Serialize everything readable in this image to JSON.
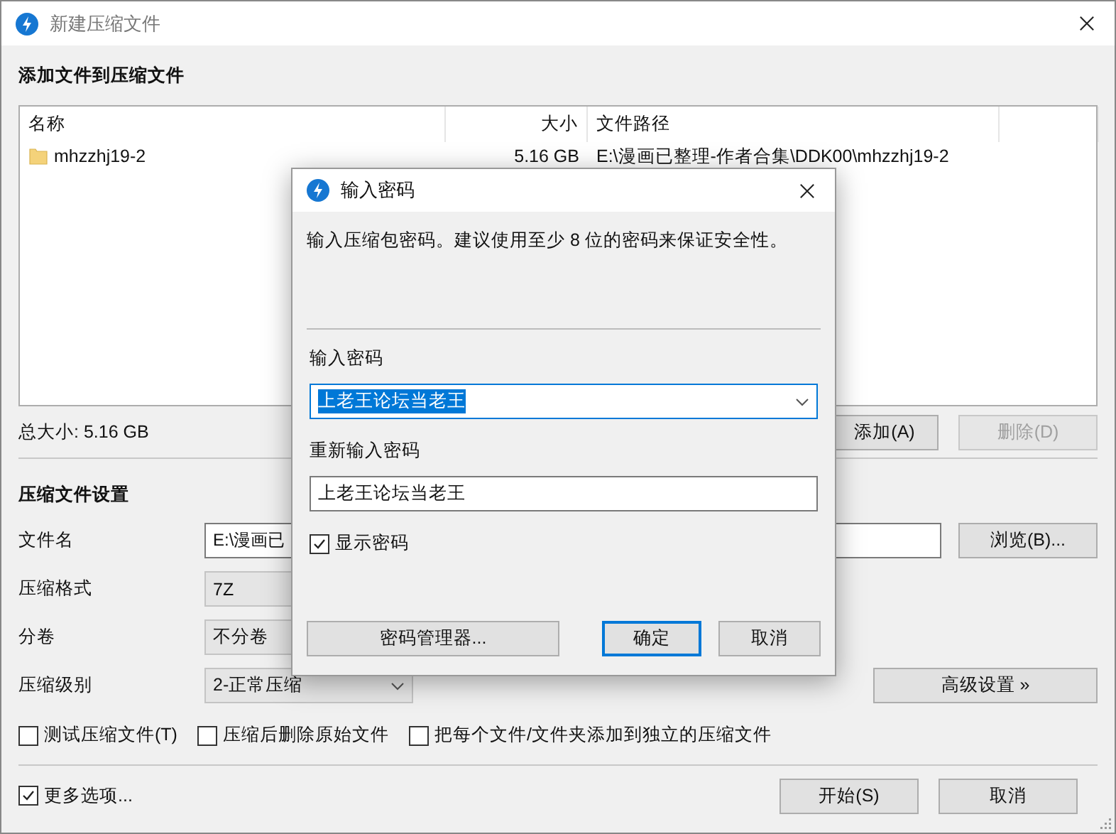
{
  "window": {
    "title": "新建压缩文件"
  },
  "files_section": {
    "heading": "添加文件到压缩文件",
    "columns": [
      "名称",
      "大小",
      "文件路径"
    ],
    "rows": [
      {
        "name": "mhzzhj19-2",
        "size": "5.16 GB",
        "path": "E:\\漫画已整理-作者合集\\DDK00\\mhzzhj19-2"
      }
    ],
    "total": "总大小: 5.16 GB",
    "buttons": [
      {
        "label": "添加(A)",
        "disabled": false
      },
      {
        "label": "删除(D)",
        "disabled": true
      }
    ]
  },
  "settings": {
    "heading": "压缩文件设置",
    "filename": {
      "label": "文件名",
      "value": "E:\\漫画已"
    },
    "browse_button": "浏览(B)...",
    "format": {
      "label": "压缩格式",
      "value": "7Z"
    },
    "split": {
      "label": "分卷",
      "value": "不分卷"
    },
    "level": {
      "label": "压缩级别",
      "value": "2-正常压缩"
    },
    "advanced_button": "高级设置 »",
    "options": [
      {
        "label": "测试压缩文件(T)",
        "checked": false
      },
      {
        "label": "压缩后删除原始文件",
        "checked": false
      },
      {
        "label": "把每个文件/文件夹添加到独立的压缩文件",
        "checked": false
      }
    ]
  },
  "footer": {
    "more_options": {
      "label": "更多选项...",
      "checked": true
    },
    "buttons": [
      {
        "label": "开始(S)"
      },
      {
        "label": "取消"
      }
    ]
  },
  "password_dialog": {
    "title": "输入密码",
    "description": "输入压缩包密码。建议使用至少 8 位的密码来保证安全性。",
    "password": {
      "label": "输入密码",
      "value": "上老王论坛当老王",
      "text_selected": true
    },
    "confirm": {
      "label": "重新输入密码",
      "value": "上老王论坛当老王"
    },
    "show_password": {
      "label": "显示密码",
      "checked": true
    },
    "buttons": [
      {
        "label": "密码管理器...",
        "default": false
      },
      {
        "label": "确定",
        "default": true
      },
      {
        "label": "取消",
        "default": false
      }
    ]
  }
}
